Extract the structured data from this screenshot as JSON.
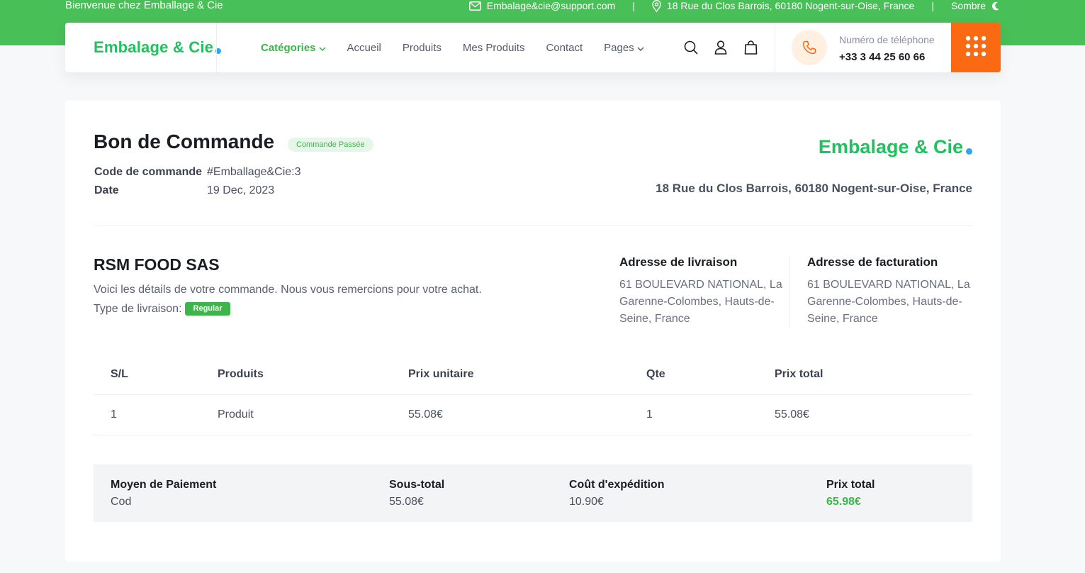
{
  "topbar": {
    "welcome": "Bienvenue chez Emballage & Cie",
    "email": "Embalage&cie@support.com",
    "address": "18 Rue du Clos Barrois, 60180 Nogent-sur-Oise, France",
    "separator": "|",
    "theme_toggle": "Sombre"
  },
  "nav": {
    "logo": "Embalage & Cie",
    "items": [
      {
        "label": "Catégories",
        "dropdown": true,
        "active": true
      },
      {
        "label": "Accueil"
      },
      {
        "label": "Produits"
      },
      {
        "label": "Mes Produits"
      },
      {
        "label": "Contact"
      },
      {
        "label": "Pages",
        "dropdown": true
      }
    ],
    "phone_label": "Numéro de téléphone",
    "phone_number": "+33 3 44 25 60 66"
  },
  "order": {
    "title": "Bon de Commande",
    "status": "Commande Passée",
    "code_label": "Code de commande",
    "code_value": "#Emballage&Cie:3",
    "date_label": "Date",
    "date_value": "19 Dec, 2023",
    "logo": "Embalage & Cie",
    "company_address": "18 Rue du Clos Barrois, 60180 Nogent-sur-Oise, France",
    "customer": "RSM FOOD SAS",
    "thanks": "Voici les détails de votre commande. Nous vous remercions pour votre achat.",
    "delivery_label": "Type de livraison:",
    "delivery_type": "Regular",
    "shipping_address_label": "Adresse de livraison",
    "shipping_address": "61 BOULEVARD NATIONAL, La Garenne-Colombes, Hauts-de-Seine, France",
    "billing_address_label": "Adresse de facturation",
    "billing_address": "61 BOULEVARD NATIONAL, La Garenne-Colombes, Hauts-de-Seine, France"
  },
  "table": {
    "headers": [
      "S/L",
      "Produits",
      "Prix unitaire",
      "Qte",
      "Prix total"
    ],
    "rows": [
      [
        "1",
        "Produit",
        "55.08€",
        "1",
        "55.08€"
      ]
    ]
  },
  "summary": {
    "payment_label": "Moyen de Paiement",
    "payment_value": "Cod",
    "subtotal_label": "Sous-total",
    "subtotal_value": "55.08€",
    "shipping_label": "Coût d'expédition",
    "shipping_value": "10.90€",
    "total_label": "Prix total",
    "total_value": "65.98€"
  },
  "colors": {
    "brand_green": "#49bf58",
    "logo_green": "#1fc25e",
    "accent_orange": "#fb6a13"
  }
}
